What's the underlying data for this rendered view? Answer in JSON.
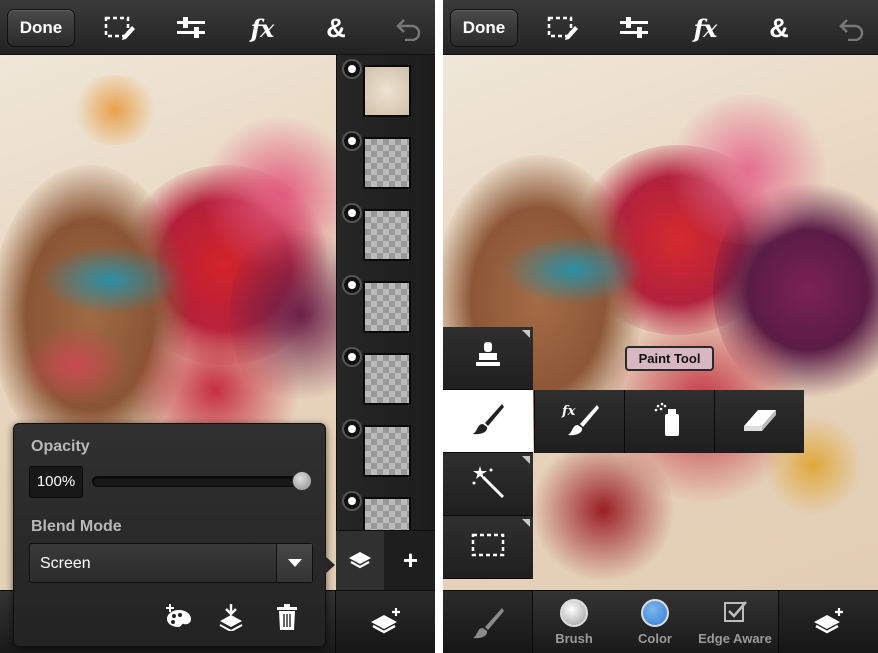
{
  "toolbar": {
    "done_label": "Done",
    "icons": [
      "selection-edit-icon",
      "adjustments-icon",
      "fx-icon",
      "ampersand-icon",
      "undo-icon"
    ],
    "fx_glyph": "fx",
    "amp_glyph": "&"
  },
  "left_screen": {
    "layers": {
      "count": 7,
      "add_glyph": "+"
    },
    "popup": {
      "opacity_label": "Opacity",
      "opacity_value": "100%",
      "opacity_level": 1.0,
      "blend_mode_label": "Blend Mode",
      "blend_mode_value": "Screen",
      "actions": [
        "add-layer-from-photo-icon",
        "merge-down-icon",
        "trash-icon"
      ]
    }
  },
  "right_screen": {
    "tools_column": [
      "stamp-icon",
      "brush-icon",
      "magic-wand-icon",
      "marquee-icon"
    ],
    "brush_options": [
      "fx-brush-icon",
      "spray-icon",
      "eraser-icon"
    ],
    "tooltip": "Paint Tool",
    "bottom_bar": {
      "brush_label": "Brush",
      "color_label": "Color",
      "edge_aware_label": "Edge Aware",
      "color_value": "#2f7fd8",
      "brush_swatch": "#9a9a9a"
    }
  },
  "colors": {
    "accent_blue": "#2f7fd8",
    "tooltip_bg": "#d7b7c2",
    "toolbar_bg": "#2b2b2b"
  }
}
